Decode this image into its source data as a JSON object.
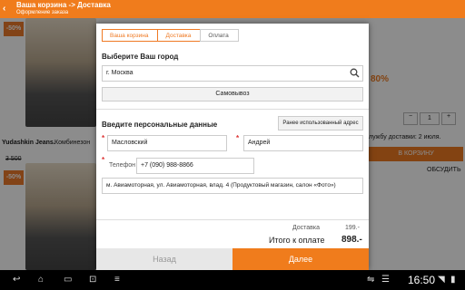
{
  "actionbar": {
    "title": "Ваша корзина -> Доставка",
    "subtitle": "Оформление заказа",
    "back_icon": "‹"
  },
  "background": {
    "discount1": "-50%",
    "discount2": "-50%",
    "product_brand": "Yudashkin Jeans.",
    "product_type": "Комбинезон",
    "old_price": "3 500",
    "percent": "80%",
    "qty": "1",
    "delivery_note": "лужбу доставки: 2 июля.",
    "cart_button": "В КОРЗИНУ",
    "discuss": "ОБСУДИТЬ"
  },
  "steps": [
    "Ваша корзина",
    "Доставка",
    "Оплата"
  ],
  "city": {
    "title": "Выберите Ваш город",
    "value": "г. Москва",
    "pickup_label": "Самовывоз"
  },
  "personal": {
    "title": "Введите персональные данные",
    "prev_button": "Ранее использованный адрес",
    "last_name": "Масловский",
    "first_name": "Андрей",
    "phone_label": "Телефон",
    "phone": "+7 (090) 988-8866",
    "address": "м. Авиамоторная, ул. Авиамоторная, влад. 4 (Продуктовый магазин, салон «Фото»)"
  },
  "summary": {
    "delivery_label": "Доставка",
    "delivery_value": "199.-",
    "total_label": "Итого к оплате",
    "total_value": "898.-"
  },
  "buttons": {
    "back": "Назад",
    "next": "Далее"
  },
  "system": {
    "time": "16:50"
  }
}
